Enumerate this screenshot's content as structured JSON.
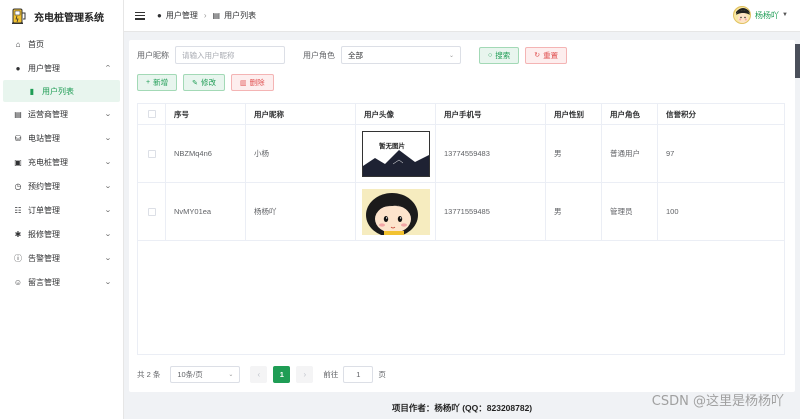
{
  "app": {
    "title": "充电桩管理系统"
  },
  "sidebar": {
    "items": [
      {
        "label": "首页",
        "icon": "home-icon",
        "glyph": "⌂",
        "has_children": false
      },
      {
        "label": "用户管理",
        "icon": "user-icon",
        "glyph": "●",
        "has_children": true,
        "expanded": true
      },
      {
        "label": "用户列表",
        "icon": "list-icon",
        "glyph": "▮",
        "active": true
      },
      {
        "label": "运营商管理",
        "icon": "building-icon",
        "glyph": "▤",
        "has_children": true
      },
      {
        "label": "电站管理",
        "icon": "plug-icon",
        "glyph": "⛁",
        "has_children": true
      },
      {
        "label": "充电桩管理",
        "icon": "charger-icon",
        "glyph": "▣",
        "has_children": true
      },
      {
        "label": "预约管理",
        "icon": "clock-icon",
        "glyph": "◷",
        "has_children": true
      },
      {
        "label": "订单管理",
        "icon": "order-icon",
        "glyph": "☷",
        "has_children": true
      },
      {
        "label": "报修管理",
        "icon": "gear-icon",
        "glyph": "✱",
        "has_children": true
      },
      {
        "label": "告警管理",
        "icon": "alert-icon",
        "glyph": "ⓘ",
        "has_children": true
      },
      {
        "label": "留言管理",
        "icon": "message-icon",
        "glyph": "☺",
        "has_children": true
      }
    ]
  },
  "header": {
    "breadcrumb": [
      {
        "label": "用户管理",
        "icon": "user-icon"
      },
      {
        "label": "用户列表",
        "icon": "list-icon"
      }
    ],
    "user_name": "杨杨吖"
  },
  "filters": {
    "nickname_label": "用户昵称",
    "nickname_placeholder": "请输入用户昵称",
    "role_label": "用户角色",
    "role_value": "全部",
    "search_label": "搜索",
    "reset_label": "重置"
  },
  "actions": {
    "add_label": "新增",
    "edit_label": "修改",
    "delete_label": "删除"
  },
  "table": {
    "columns": [
      "序号",
      "用户昵称",
      "用户头像",
      "用户手机号",
      "用户性别",
      "用户角色",
      "信誉积分"
    ],
    "rows": [
      {
        "id": "NBZMq4n6",
        "nickname": "小杨",
        "avatar_text": "暂无图片",
        "phone": "13774559483",
        "gender": "男",
        "role": "普通用户",
        "score": "97"
      },
      {
        "id": "NvMY01ea",
        "nickname": "杨杨吖",
        "avatar_text": "",
        "phone": "13771559485",
        "gender": "男",
        "role": "管理员",
        "score": "100"
      }
    ]
  },
  "pagination": {
    "total_text": "共 2 条",
    "page_size": "10条/页",
    "prev": "‹",
    "current": "1",
    "next": "›",
    "goto_label": "前往",
    "goto_value": "1",
    "page_unit": "页"
  },
  "footer": {
    "text": "项目作者：杨杨吖 (QQ：823208782)"
  },
  "watermark": {
    "text": "CSDN @这里是杨杨吖"
  },
  "colors": {
    "primary": "#1f9d55",
    "danger": "#e05050"
  }
}
